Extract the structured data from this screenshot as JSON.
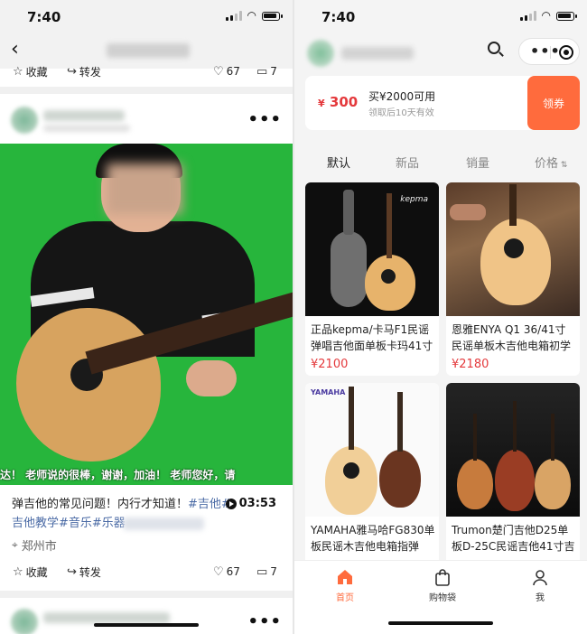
{
  "left_screen": {
    "status_time": "7:40",
    "actions_top": {
      "collect_label": "收藏",
      "share_label": "转发",
      "likes": "67",
      "comments": "7"
    },
    "video": {
      "subtitle": "达！ 老师说的很棒，谢谢，加油！ 老师您好，请"
    },
    "caption_text": "弹吉他的常见问题！内行才知道！",
    "caption_tags_line1": "#吉他#",
    "caption_tags_line2": "吉他教学#音乐#乐器",
    "duration": "03:53",
    "location": "郑州市",
    "actions_bottom": {
      "collect_label": "收藏",
      "share_label": "转发",
      "likes": "67",
      "comments": "7"
    }
  },
  "right_screen": {
    "status_time": "7:40",
    "coupon": {
      "currency": "¥",
      "amount": "300",
      "condition": "买¥2000可用",
      "validity": "领取后10天有效",
      "claim_label": "领券"
    },
    "sort_tabs": [
      "默认",
      "新品",
      "销量",
      "价格"
    ],
    "products": [
      {
        "title": "正品kepma/卡马F1民谣弹唱吉他面单板卡玛41寸",
        "price": "¥2100"
      },
      {
        "title": "恩雅ENYA Q1 36/41寸民谣单板木吉他电箱初学",
        "price": "¥2180"
      },
      {
        "title": "YAMAHA雅马哈FG830单板民谣木吉他电箱指弹",
        "price": ""
      },
      {
        "title": "Trumon楚门吉他D25单板D-25C民谣吉他41寸吉",
        "price": ""
      }
    ],
    "product_image_text": {
      "kepma": "kepma",
      "yamaha": "YAMAHA"
    },
    "tabbar": [
      {
        "label": "首页",
        "icon": "home-icon"
      },
      {
        "label": "购物袋",
        "icon": "shopping-bag-icon"
      },
      {
        "label": "我",
        "icon": "person-icon"
      }
    ],
    "accent_color": "#ff6b3d",
    "price_color": "#e4393c"
  }
}
